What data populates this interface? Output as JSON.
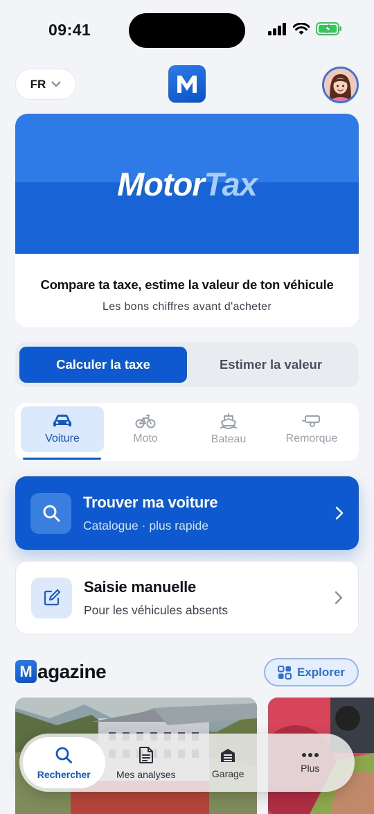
{
  "status_bar": {
    "time": "09:41"
  },
  "header": {
    "language": "FR",
    "app_logo_letter": "M"
  },
  "hero": {
    "brand_part1": "Motor",
    "brand_part2": "Tax",
    "title": "Compare ta taxe, estime la valeur de ton véhicule",
    "subtitle": "Les bons chiffres avant d'acheter"
  },
  "segmented": {
    "options": [
      "Calculer la taxe",
      "Estimer la valeur"
    ],
    "selected": "Calculer la taxe"
  },
  "vehicle_tabs": [
    {
      "label": "Voiture",
      "icon": "car-icon",
      "active": true
    },
    {
      "label": "Moto",
      "icon": "bicycle-icon",
      "active": false
    },
    {
      "label": "Bateau",
      "icon": "boat-icon",
      "active": false
    },
    {
      "label": "Remorque",
      "icon": "trailer-icon",
      "active": false
    }
  ],
  "actions": {
    "primary": {
      "title": "Trouver ma voiture",
      "subtitle": "Catalogue · plus rapide",
      "icon": "search-icon"
    },
    "secondary": {
      "title": "Saisie manuelle",
      "subtitle": "Pour les véhicules absents",
      "icon": "edit-icon"
    }
  },
  "magazine": {
    "logo_letter": "M",
    "title_rest": "agazine",
    "explore_label": "Explorer"
  },
  "bottom_nav": [
    {
      "label": "Rechercher",
      "icon": "search-icon",
      "active": true
    },
    {
      "label": "Mes analyses",
      "icon": "document-icon",
      "active": false
    },
    {
      "label": "Garage",
      "icon": "garage-icon",
      "active": false
    },
    {
      "label": "Plus",
      "icon": "more-icon",
      "active": false
    }
  ],
  "colors": {
    "primary": "#0e59cf",
    "background": "#f2f4f7",
    "battery": "#34c759"
  }
}
